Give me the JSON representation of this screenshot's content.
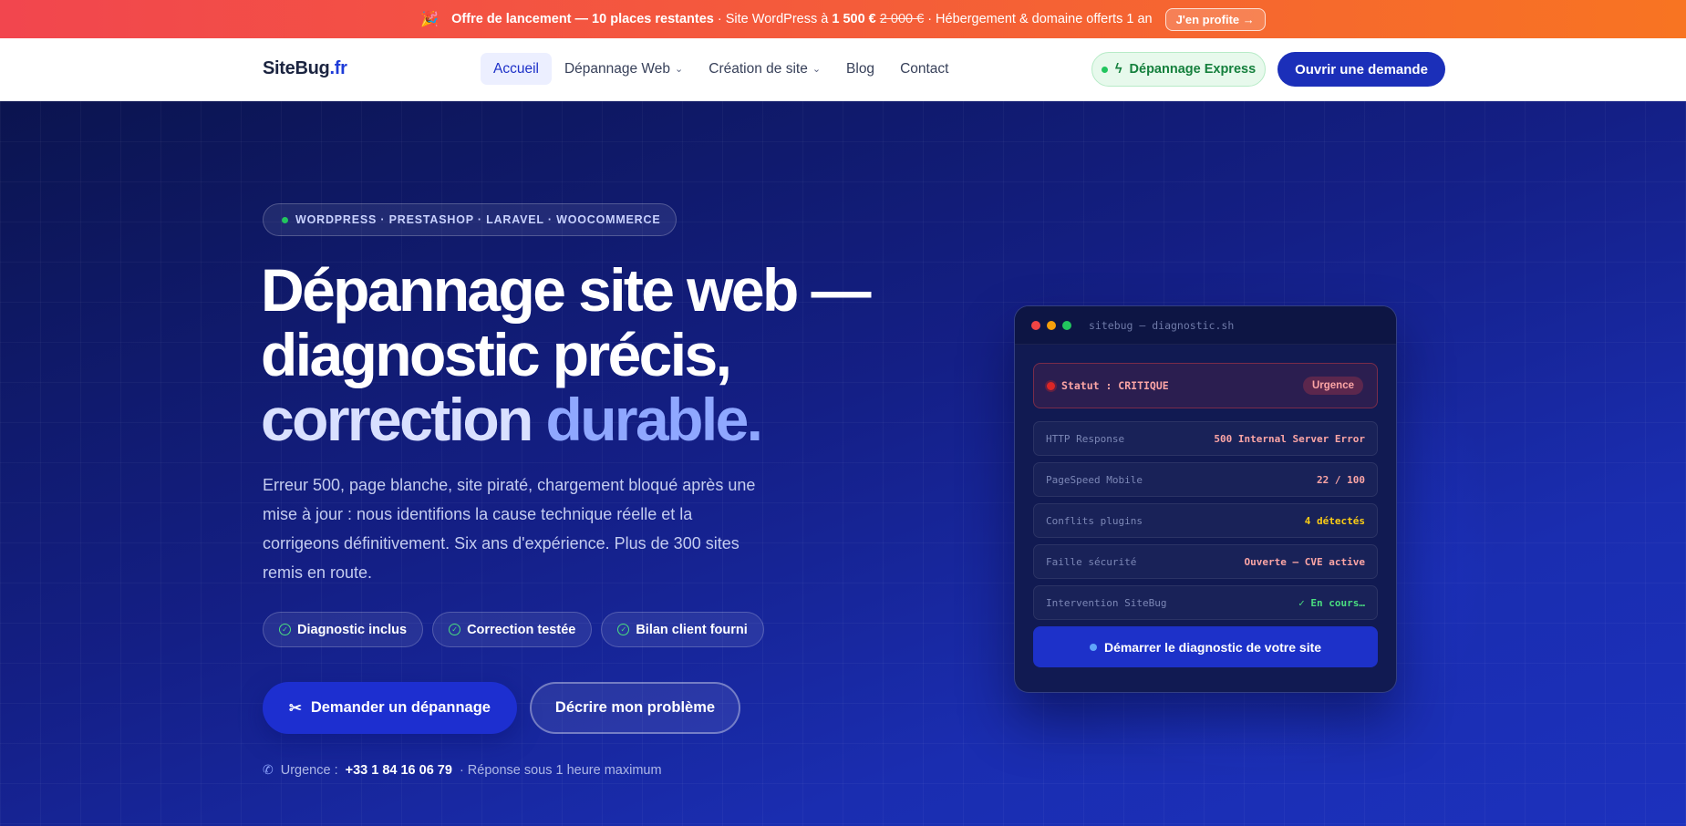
{
  "promo": {
    "icon": "party-popper-icon",
    "headline": "Offre de lancement — 10 places restantes",
    "offer": "· Site WordPress à",
    "new_price": "1 500 €",
    "old_price": "2 000 €",
    "extra": "· Hébergement & domaine offerts 1 an",
    "cta": "J'en profite →"
  },
  "nav": {
    "logo_name": "SiteBug",
    "logo_tld": ".fr",
    "items": [
      {
        "label": "Accueil",
        "active": true
      },
      {
        "label": "Dépannage Web",
        "dropdown": true
      },
      {
        "label": "Création de site",
        "dropdown": true
      },
      {
        "label": "Blog"
      },
      {
        "label": "Contact"
      }
    ],
    "express_label": "Dépannage Express",
    "cta_label": "Ouvrir une demande"
  },
  "hero": {
    "tags": "WORDPRESS · PRESTASHOP · LARAVEL · WOOCOMMERCE",
    "title_line1": "Dépannage site web —",
    "title_line2": "diagnostic précis,",
    "title_line3_a": "correction",
    "title_line3_b": "durable.",
    "lead": "Erreur 500, page blanche, site piraté, chargement bloqué après une mise à jour : nous identifions la cause technique réelle et la corrigeons définitivement. Six ans d'expérience. Plus de 300 sites remis en route.",
    "chips": [
      "Diagnostic inclus",
      "Correction testée",
      "Bilan client fourni"
    ],
    "primary_cta": "Demander un dépannage",
    "secondary_cta": "Décrire mon problème",
    "urgence_label": "Urgence :",
    "phone": "+33 1 84 16 06 79",
    "response": "· Réponse sous 1 heure maximum"
  },
  "terminal": {
    "title": "sitebug — diagnostic.sh",
    "status_label": "Statut : CRITIQUE",
    "status_badge": "Urgence",
    "rows": [
      {
        "key": "HTTP Response",
        "value": "500 Internal Server Error",
        "tone": "red"
      },
      {
        "key": "PageSpeed Mobile",
        "value": "22 / 100",
        "tone": "red"
      },
      {
        "key": "Conflits plugins",
        "value": "4 détectés",
        "tone": "amber"
      },
      {
        "key": "Faille sécurité",
        "value": "Ouverte — CVE active",
        "tone": "red"
      },
      {
        "key": "Intervention SiteBug",
        "value": "✓ En cours…",
        "tone": "green"
      }
    ],
    "cta": "Démarrer le diagnostic de votre site"
  },
  "colors": {
    "brand": "#1d3bd8",
    "promo_start": "#f2464e",
    "promo_end": "#f87422",
    "hero_dark": "#0b144f",
    "accent_light": "#8fa7ff",
    "success": "#22c55e",
    "danger": "#ef4444"
  }
}
